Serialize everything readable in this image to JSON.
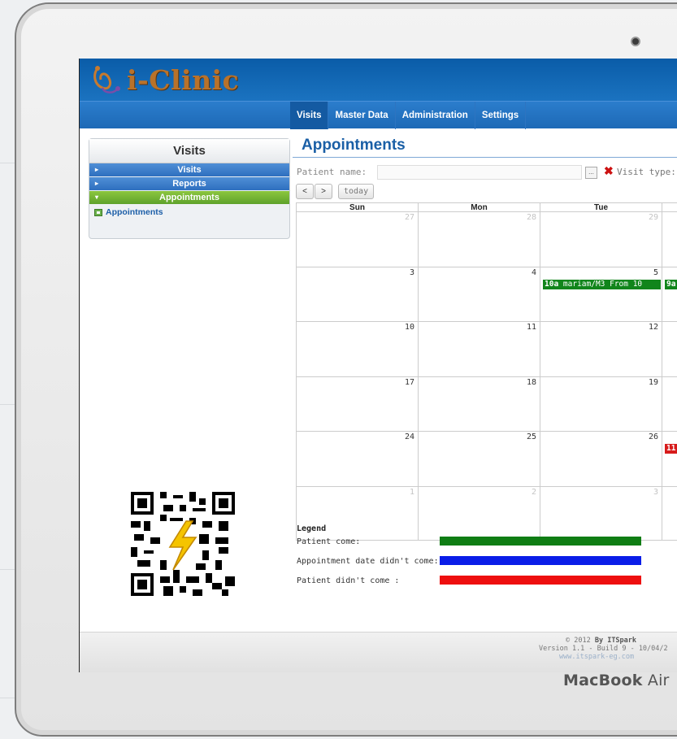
{
  "app": {
    "logo_text": "i-Clinic"
  },
  "nav": {
    "items": [
      "Visits",
      "Master Data",
      "Administration",
      "Settings"
    ],
    "active": "Visits"
  },
  "sidebar": {
    "title": "Visits",
    "sections": [
      {
        "label": "Visits",
        "color": "blue"
      },
      {
        "label": "Reports",
        "color": "blue"
      },
      {
        "label": "Appointments",
        "color": "green"
      }
    ],
    "sub_item": "Appointments"
  },
  "page": {
    "title": "Appointments",
    "patient_name_label": "Patient name:",
    "patient_name_value": "",
    "browse_label": "...",
    "visit_type_label": "Visit type:"
  },
  "calendar_nav": {
    "prev": "<",
    "next": ">",
    "today": "today"
  },
  "calendar": {
    "days": [
      "Sun",
      "Mon",
      "Tue"
    ],
    "weeks": [
      {
        "cells": [
          {
            "n": "27",
            "other": true
          },
          {
            "n": "28",
            "other": true
          },
          {
            "n": "29",
            "other": true
          }
        ]
      },
      {
        "cells": [
          {
            "n": "3"
          },
          {
            "n": "4"
          },
          {
            "n": "5"
          }
        ]
      },
      {
        "cells": [
          {
            "n": "10"
          },
          {
            "n": "11"
          },
          {
            "n": "12"
          }
        ]
      },
      {
        "cells": [
          {
            "n": "17"
          },
          {
            "n": "18"
          },
          {
            "n": "19"
          }
        ]
      },
      {
        "cells": [
          {
            "n": "24"
          },
          {
            "n": "25"
          },
          {
            "n": "26"
          }
        ]
      },
      {
        "cells": [
          {
            "n": "1",
            "other": true
          },
          {
            "n": "2",
            "other": true
          },
          {
            "n": "3",
            "other": true
          }
        ]
      }
    ],
    "events": [
      {
        "week": 1,
        "time": "10a",
        "text": "mariam/M3 From 10",
        "status": "Patient come",
        "color": "#11851b"
      },
      {
        "week": 1,
        "time": "9a",
        "text": "",
        "status": "Patient come",
        "color": "#11851b"
      },
      {
        "week": 4,
        "time": "11",
        "text": "",
        "status": "Patient didn't come",
        "color": "#d71b1b"
      }
    ]
  },
  "legend": {
    "title": "Legend",
    "items": [
      {
        "label": "Patient come:",
        "color": "#0f7d14"
      },
      {
        "label": "Appointment date didn't come:",
        "color": "#0a1de8"
      },
      {
        "label": "Patient didn't come :",
        "color": "#ee0f0f"
      }
    ]
  },
  "footer": {
    "copyright": "© 2012",
    "by": "By ITSpark",
    "version": "Version 1.1 - Build 9 - 10/04/2",
    "url": "www.itspark-eg.com"
  },
  "device": {
    "brand_bold": "MacBook",
    "brand_light": "Air"
  }
}
